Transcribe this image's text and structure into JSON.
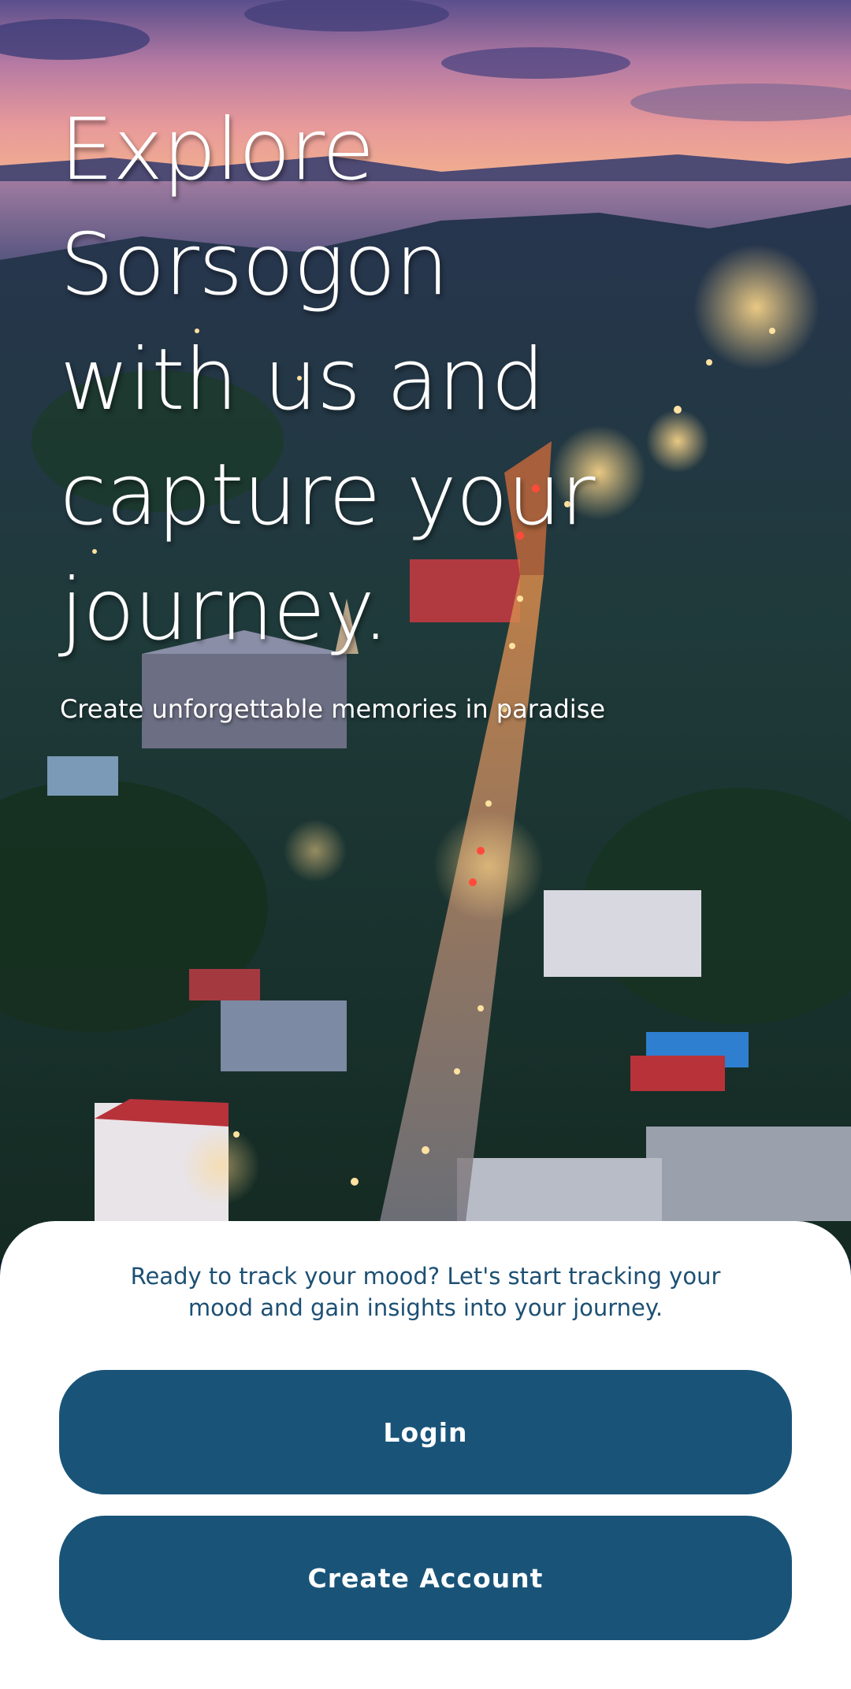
{
  "hero": {
    "title": "Explore Sorsogon with us and capture your journey.",
    "subtitle": "Create unforgettable memories in paradise",
    "background_image": "aerial-town-at-dusk"
  },
  "sheet": {
    "message": "Ready to track your mood? Let's start tracking your mood and gain insights into your journey.",
    "login_label": "Login",
    "create_account_label": "Create Account"
  },
  "colors": {
    "primary_button": "#195478",
    "message_text": "#1d5073",
    "sheet_background": "#ffffff",
    "hero_text": "#ffffff"
  }
}
